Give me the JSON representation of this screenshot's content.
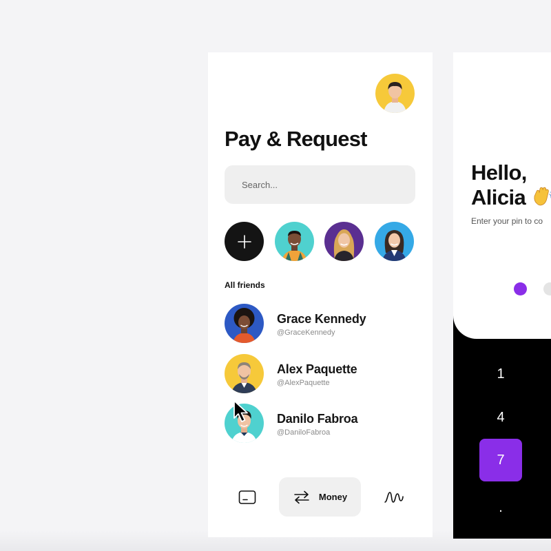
{
  "pay_screen": {
    "title": "Pay & Request",
    "search": {
      "placeholder": "Search..."
    },
    "section_label": "All friends",
    "friends": [
      {
        "name": "Grace Kennedy",
        "handle": "@GraceKennedy"
      },
      {
        "name": "Alex Paquette",
        "handle": "@AlexPaquette"
      },
      {
        "name": "Danilo Fabroa",
        "handle": "@DaniloFabroa"
      }
    ],
    "nav": {
      "money_label": "Money"
    }
  },
  "login_screen": {
    "greeting_line1": "Hello,",
    "greeting_line2": "Alicia",
    "instruction": "Enter your pin to co",
    "keys": [
      "1",
      "4",
      "7",
      "."
    ]
  },
  "colors": {
    "accent": "#8a2ee8",
    "dark": "#141414",
    "background": "#f4f4f6"
  },
  "icons": [
    "profile-avatar",
    "plus-icon",
    "card-icon",
    "transfer-arrows-icon",
    "activity-wave-icon",
    "waving-hand-icon",
    "mouse-cursor"
  ]
}
